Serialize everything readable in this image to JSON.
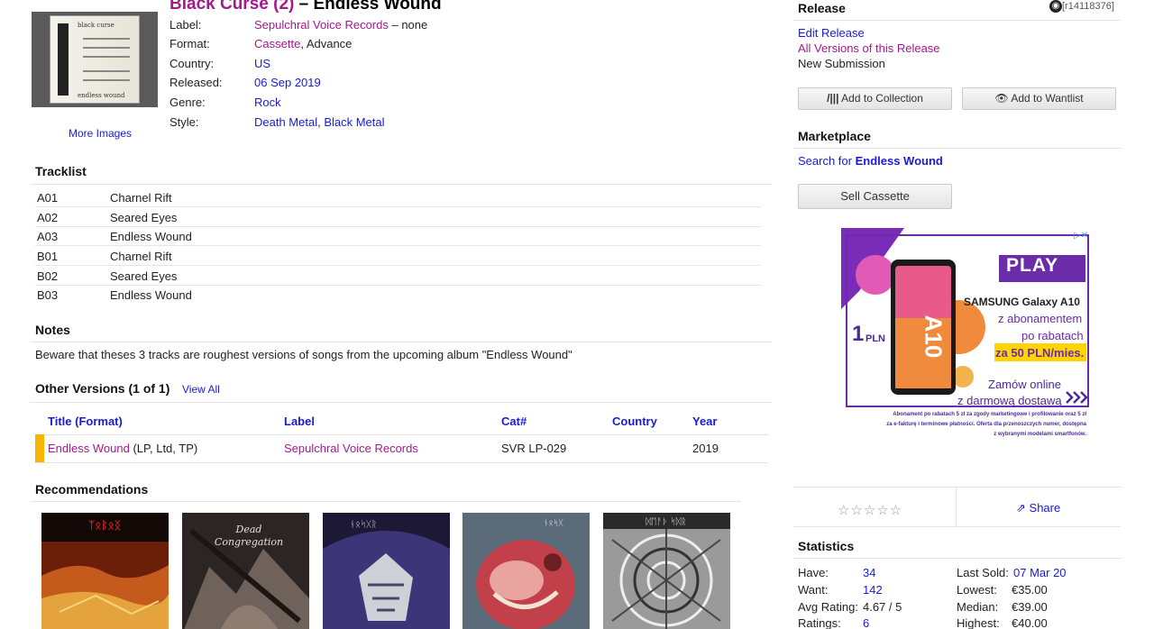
{
  "header": {
    "artist": "Black Curse (2)",
    "separator": " – ",
    "title": "Endless Wound",
    "more_images": "More Images",
    "cover_artist": "black curse",
    "cover_title": "endless wound",
    "info": {
      "label_key": "Label:",
      "label_val": "Sepulchral Voice Records",
      "label_suffix": " – none",
      "format_key": "Format:",
      "format_val": "Cassette",
      "format_suffix": ", Advance",
      "country_key": "Country:",
      "country_val": "US",
      "released_key": "Released:",
      "released_val": "06 Sep 2019",
      "genre_key": "Genre:",
      "genre_val": "Rock",
      "style_key": "Style:",
      "style_val1": "Death Metal",
      "style_sep": ", ",
      "style_val2": "Black Metal"
    }
  },
  "tracklist": {
    "heading": "Tracklist",
    "tracks": [
      {
        "pos": "A01",
        "title": "Charnel Rift"
      },
      {
        "pos": "A02",
        "title": "Seared Eyes"
      },
      {
        "pos": "A03",
        "title": "Endless Wound"
      },
      {
        "pos": "B01",
        "title": "Charnel Rift"
      },
      {
        "pos": "B02",
        "title": "Seared Eyes"
      },
      {
        "pos": "B03",
        "title": "Endless Wound"
      }
    ]
  },
  "notes": {
    "heading": "Notes",
    "text": "Beware that theses 3 tracks are roughest versions of songs from the upcoming album \"Endless Wound\""
  },
  "versions": {
    "heading": "Other Versions (1 of 1)",
    "view_all": "View All",
    "col_title": "Title",
    "col_format": "Format",
    "col_label": "Label",
    "col_cat": "Cat#",
    "col_country": "Country",
    "col_year": "Year",
    "row": {
      "title": "Endless Wound",
      "format": " (LP, Ltd, TP)",
      "label": "Sepulchral Voice Records",
      "cat": "SVR LP-029",
      "country": "",
      "year": "2019"
    }
  },
  "recommendations": {
    "heading": "Recommendations",
    "items": [
      {
        "icon": "album-cover-1",
        "color": "#b0461a"
      },
      {
        "icon": "album-cover-2",
        "color": "#3a3532"
      },
      {
        "icon": "album-cover-3",
        "color": "#3b3566"
      },
      {
        "icon": "album-cover-4",
        "color": "#a03440"
      },
      {
        "icon": "album-cover-5",
        "color": "#8a8a8a"
      }
    ]
  },
  "sidebar": {
    "release_heading": "Release",
    "release_id": "[r14118376]",
    "edit_release": "Edit Release",
    "all_versions": "All Versions of this Release",
    "new_submission": "New Submission",
    "add_collection": "Add to Collection",
    "add_wantlist": "Add to Wantlist",
    "marketplace_heading": "Marketplace",
    "search_for": "Search for ",
    "search_term": "Endless Wound",
    "sell_button": "Sell Cassette",
    "ad": {
      "brand": "PLAY",
      "phone_model": "SAMSUNG Galaxy A10",
      "line1": "z abonamentem",
      "line2": "po rabatach",
      "price": "za 50 PLN/mies.",
      "price_big": "1",
      "price_unit": "PLN",
      "phone_label": "A10",
      "cta1": "Zamów online",
      "cta2": "z darmową dostawą",
      "fine1": "Abonament po rabatach 5 zł za zgody marketingowe i profilowanie oraz 5 zł",
      "fine2": "za e-fakturę i terminowe płatności. Oferta dla przenoszczych numer, dostępna",
      "fine3": "z wybranymi modelami smartfonów."
    },
    "stars": "☆☆☆☆☆",
    "share": "Share",
    "statistics_heading": "Statistics",
    "stats": {
      "have_key": "Have:",
      "have_val": "34",
      "want_key": "Want:",
      "want_val": "142",
      "avg_key": "Avg Rating:",
      "avg_val": "4.67 / 5",
      "ratings_key": "Ratings:",
      "ratings_val": "6",
      "last_sold_key": "Last Sold:",
      "last_sold_val": "07 Mar 20",
      "lowest_key": "Lowest:",
      "lowest_val": "€35.00",
      "median_key": "Median:",
      "median_val": "€39.00",
      "highest_key": "Highest:",
      "highest_val": "€40.00"
    }
  }
}
